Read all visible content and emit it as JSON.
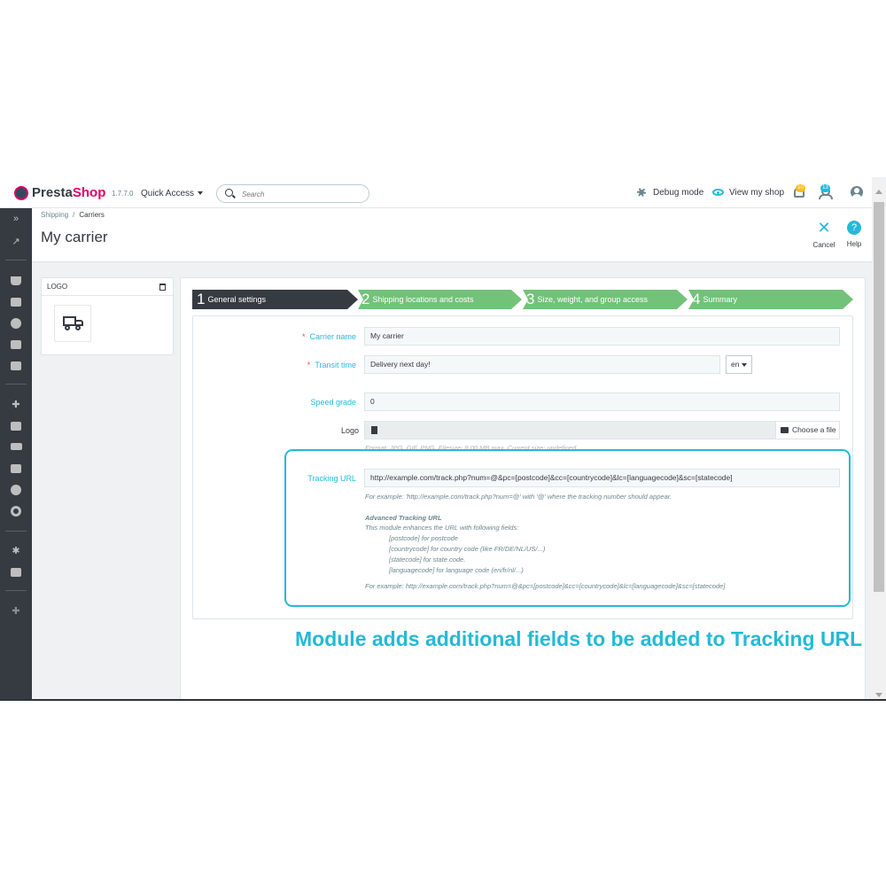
{
  "header": {
    "brand_part1": "Presta",
    "brand_part2": "Shop",
    "version": "1.7.7.0",
    "quick_access": "Quick Access",
    "search_placeholder": "Search",
    "debug_mode": "Debug mode",
    "view_shop": "View my shop",
    "notif_count_orders": "10",
    "notif_count_customers": "13"
  },
  "breadcrumb": {
    "parent": "Shipping",
    "separator": "/",
    "current": "Carriers"
  },
  "page": {
    "title": "My carrier"
  },
  "toolbar": {
    "cancel_label": "Cancel",
    "help_label": "Help",
    "help_glyph": "?"
  },
  "logo_panel": {
    "title": "LOGO"
  },
  "steps": [
    {
      "num": "1",
      "label": "General settings"
    },
    {
      "num": "2",
      "label": "Shipping locations and costs"
    },
    {
      "num": "3",
      "label": "Size, weight, and group access"
    },
    {
      "num": "4",
      "label": "Summary"
    }
  ],
  "form": {
    "required_mark": "*",
    "carrier_name_label": "Carrier name",
    "carrier_name_value": "My carrier",
    "transit_time_label": "Transit time",
    "transit_time_value": "Delivery next day!",
    "lang": "en",
    "speed_grade_label": "Speed grade",
    "speed_grade_value": "0",
    "logo_label": "Logo",
    "choose_file": "Choose a file",
    "logo_help": "Format: JPG, GIF, PNG. Filesize: 8.00 MB max. Current size: undefined.",
    "tracking_url_label": "Tracking URL",
    "tracking_url_value": "http://example.com/track.php?num=@&pc=[postcode]&cc=[countrycode]&lc=[languagecode]&sc=[statecode]",
    "tracking_example": "For example: 'http://example.com/track.php?num=@' with '@' where the tracking number should appear.",
    "advanced_title": "Advanced Tracking URL",
    "advanced_intro": "This module enhances the URL with following fields:",
    "advanced_fields": [
      "[postcode] for postcode",
      "[countrycode] for country code (like FR/DE/NL/US/...)",
      "[statecode] for state code.",
      "[languagecode] for language code (en/fr/nl/...)"
    ],
    "advanced_example": "For example: http://example.com/track.php?num=@&pc=[postcode]&cc=[countrycode]&lc=[languagecode]&sc=[statecode]"
  },
  "caption": "Module adds additional fields to be added to Tracking URL",
  "colors": {
    "brand_pink": "#df0067",
    "accent_blue": "#25b9d7",
    "step_active": "#363a41",
    "step_inactive": "#72c279",
    "sidebar": "#363a41"
  },
  "icons": {
    "sidebar": [
      "expand-icon",
      "stats-icon",
      "orders-icon",
      "catalog-icon",
      "customers-icon",
      "messages-icon",
      "reports-icon",
      "modules-icon",
      "design-icon",
      "shipping-icon",
      "payment-icon",
      "international-icon",
      "marketing-icon",
      "settings-icon",
      "advanced-settings-icon",
      "extension-icon"
    ]
  }
}
